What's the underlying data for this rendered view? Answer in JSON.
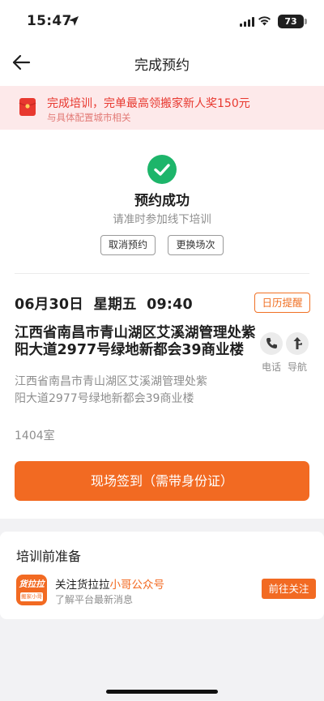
{
  "status_bar": {
    "time": "15:47",
    "battery": "73"
  },
  "nav": {
    "title": "完成预约"
  },
  "banner": {
    "title": "完成培训，完单最高领搬家新人奖150元",
    "subtitle": "与具体配置城市相关"
  },
  "success": {
    "title": "预约成功",
    "subtitle": "请准时参加线下培训",
    "cancel_label": "取消预约",
    "change_label": "更换场次"
  },
  "appointment": {
    "datetime": "06月30日  星期五  09:40",
    "calendar_label": "日历提醒",
    "address_bold": "江西省南昌市青山湖区艾溪湖管理处紫阳大道2977号绿地新都会39商业楼",
    "address_detail": "江西省南昌市青山湖区艾溪湖管理处紫阳大道2977号绿地新都会39商业楼",
    "room": "1404室",
    "phone_label": "电话",
    "navigate_label": "导航",
    "signin_label": "现场签到（需带身份证）"
  },
  "preparation": {
    "title": "培训前准备",
    "logo_text": "货拉拉",
    "logo_sub": "搬家小哥",
    "follow_title_prefix": "关注货拉拉",
    "follow_title_highlight": "小哥公众号",
    "follow_subtitle": "了解平台最新消息",
    "follow_button": "前往关注"
  },
  "colors": {
    "accent": "#f26a22",
    "success": "#1db56a",
    "banner_bg": "#fde9ea",
    "banner_text": "#e8382f"
  },
  "icons": {
    "back": "arrow-left-icon",
    "redpacket": "red-packet-icon",
    "check": "check-icon",
    "phone": "phone-icon",
    "navigate": "navigation-arrow-icon"
  }
}
